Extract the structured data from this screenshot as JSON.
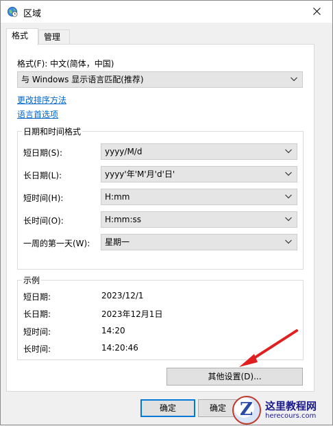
{
  "window": {
    "title": "区域",
    "icon": "globe-clock-icon",
    "close_icon": "close-icon"
  },
  "tabs": [
    {
      "label": "格式",
      "active": true
    },
    {
      "label": "管理",
      "active": false
    }
  ],
  "format": {
    "label": "格式(F): 中文(简体，中国)",
    "dropdown_value": "与 Windows 显示语言匹配(推荐)"
  },
  "links": {
    "sort_method": "更改排序方法",
    "language_prefs": "语言首选项"
  },
  "datetime": {
    "group_title": "日期和时间格式",
    "rows": [
      {
        "label": "短日期(S):",
        "value": "yyyy/M/d"
      },
      {
        "label": "长日期(L):",
        "value": "yyyy'年'M'月'd'日'"
      },
      {
        "label": "短时间(H):",
        "value": "H:mm"
      },
      {
        "label": "长时间(O):",
        "value": "H:mm:ss"
      },
      {
        "label": "一周的第一天(W):",
        "value": "星期一"
      }
    ]
  },
  "examples": {
    "group_title": "示例",
    "rows": [
      {
        "label": "短日期:",
        "value": "2023/12/1"
      },
      {
        "label": "长日期:",
        "value": "2023年12月1日"
      },
      {
        "label": "短时间:",
        "value": "14:20"
      },
      {
        "label": "长时间:",
        "value": "14:20:46"
      }
    ]
  },
  "buttons": {
    "other_settings": "其他设置(D)...",
    "ok": "确定",
    "apply": "确定"
  },
  "watermark": {
    "logo_letter": "Z",
    "text_main": "这里教程网",
    "text_sub": "herecours.com"
  },
  "colors": {
    "accent": "#0078d7",
    "link": "#0066cc",
    "arrow": "#e02020"
  }
}
